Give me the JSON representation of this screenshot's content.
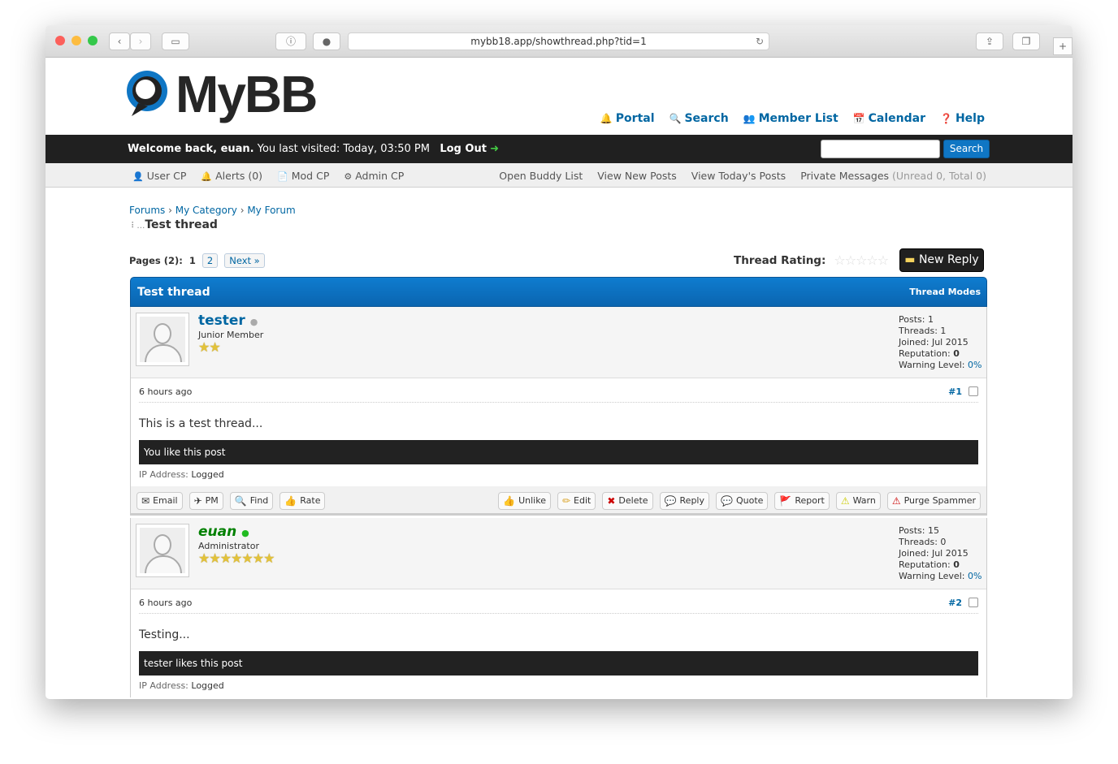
{
  "browser": {
    "url": "mybb18.app/showthread.php?tid=1"
  },
  "logo": "MyBB",
  "toplinks": [
    {
      "icon": "bell-icon",
      "glyph": "🔔",
      "label": "Portal"
    },
    {
      "icon": "search-icon",
      "glyph": "🔍",
      "label": "Search"
    },
    {
      "icon": "members-icon",
      "glyph": "👥",
      "label": "Member List"
    },
    {
      "icon": "calendar-icon",
      "glyph": "📅",
      "label": "Calendar"
    },
    {
      "icon": "help-icon",
      "glyph": "❓",
      "label": "Help"
    }
  ],
  "welcome": {
    "greeting": "Welcome back, euan.",
    "last_visit": "You last visited: Today, 03:50 PM",
    "logout": "Log Out",
    "search_button": "Search",
    "search_placeholder": ""
  },
  "panel": {
    "left": [
      {
        "glyph": "👤",
        "label": "User CP"
      },
      {
        "glyph": "🔔",
        "label": "Alerts (0)"
      },
      {
        "glyph": "📄",
        "label": "Mod CP"
      },
      {
        "glyph": "⚙",
        "label": "Admin CP"
      }
    ],
    "right": [
      "Open Buddy List",
      "View New Posts",
      "View Today's Posts"
    ],
    "pm": "Private Messages",
    "pm_counts": "(Unread 0, Total 0)"
  },
  "breadcrumb": [
    "Forums",
    "My Category",
    "My Forum"
  ],
  "thread_title": "Test thread",
  "pages": {
    "label": "Pages (2):",
    "current": "1",
    "other": "2",
    "next": "Next »"
  },
  "rating_label": "Thread Rating:",
  "rating": 0,
  "new_reply": "New Reply",
  "thead": {
    "title": "Test thread",
    "modes": "Thread Modes"
  },
  "posts": [
    {
      "author": "tester",
      "color": "#0066a2",
      "online": false,
      "title": "Junior Member",
      "stars": "★★",
      "stats": {
        "posts": "Posts: 1",
        "threads": "Threads: 1",
        "joined": "Joined: Jul 2015",
        "rep_label": "Reputation:",
        "rep": "0",
        "warn_label": "Warning Level:",
        "warn": "0%"
      },
      "time": "6 hours ago",
      "num": "#1",
      "body": "This is a test thread...",
      "likes": "You like this post",
      "ip_label": "IP Address:",
      "ip": "Logged"
    },
    {
      "author": "euan",
      "color": "#008000",
      "online": true,
      "title": "Administrator",
      "stars": "★★★★★★★",
      "stats": {
        "posts": "Posts: 15",
        "threads": "Threads: 0",
        "joined": "Joined: Jul 2015",
        "rep_label": "Reputation:",
        "rep": "0",
        "warn_label": "Warning Level:",
        "warn": "0%"
      },
      "time": "6 hours ago",
      "num": "#2",
      "body": "Testing...",
      "likes": "tester likes this post",
      "ip_label": "IP Address:",
      "ip": "Logged"
    }
  ],
  "post_buttons_left": [
    {
      "glyph": "✉",
      "label": "Email"
    },
    {
      "glyph": "✈",
      "label": "PM"
    },
    {
      "glyph": "🔍",
      "label": "Find"
    },
    {
      "glyph": "👍",
      "label": "Rate"
    }
  ],
  "post_buttons_right": [
    {
      "glyph": "👍",
      "label": "Unlike"
    },
    {
      "glyph": "✏",
      "label": "Edit"
    },
    {
      "glyph": "✖",
      "label": "Delete"
    },
    {
      "glyph": "💬",
      "label": "Reply"
    },
    {
      "glyph": "💬",
      "label": "Quote"
    },
    {
      "glyph": "🚩",
      "label": "Report"
    },
    {
      "glyph": "⚠",
      "label": "Warn"
    },
    {
      "glyph": "⚠",
      "label": "Purge Spammer"
    }
  ]
}
